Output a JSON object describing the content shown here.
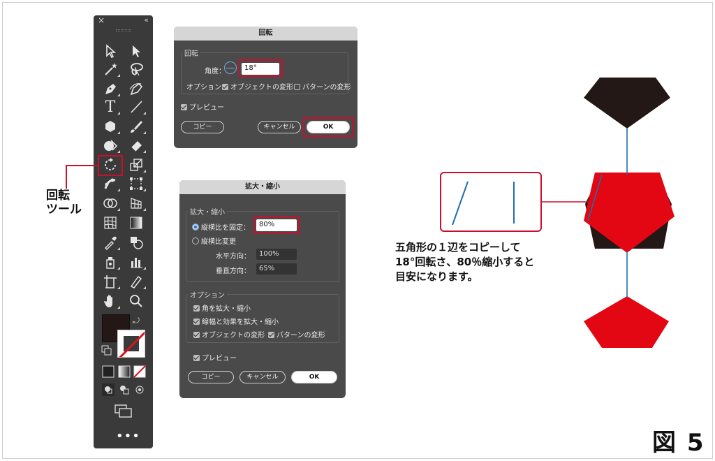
{
  "toolbar": {
    "close_icon": "×",
    "collapse_icon": "«",
    "more_label": "•••"
  },
  "annotation": {
    "line1": "回転",
    "line2": "ツール"
  },
  "rotate_dialog": {
    "title": "回転",
    "group_label": "回転",
    "angle_label": "角度：",
    "angle_value": "18°",
    "options_label": "オプション：",
    "opt_transform_objects": "オブジェクトの変形",
    "opt_transform_patterns": "パターンの変形",
    "preview_label": "プレビュー",
    "copy_button": "コピー",
    "cancel_button": "キャンセル",
    "ok_button": "OK"
  },
  "scale_dialog": {
    "title": "拡大・縮小",
    "group_label": "拡大・縮小",
    "uniform_label": "縦横比を固定：",
    "uniform_value": "80%",
    "nonuniform_label": "縦横比変更",
    "horizontal_label": "水平方向：",
    "horizontal_value": "100%",
    "vertical_label": "垂直方向：",
    "vertical_value": "65%",
    "options_group_label": "オプション",
    "opt_scale_corners": "角を拡大・縮小",
    "opt_scale_strokes": "線幅と効果を拡大・縮小",
    "opt_transform_objects": "オブジェクトの変形",
    "opt_transform_patterns": "パターンの変形",
    "preview_label": "プレビュー",
    "copy_button": "コピー",
    "cancel_button": "キャンセル",
    "ok_button": "OK"
  },
  "note": {
    "line1": "五角形の１辺をコピーして",
    "line2": "18°回転さ、80％縮小すると",
    "line3": "目安になります。"
  },
  "figure_label": "図 5",
  "colors": {
    "red": "#e30613",
    "black": "#231815",
    "blue": "#1f6fae",
    "highlight": "#c8102e"
  }
}
